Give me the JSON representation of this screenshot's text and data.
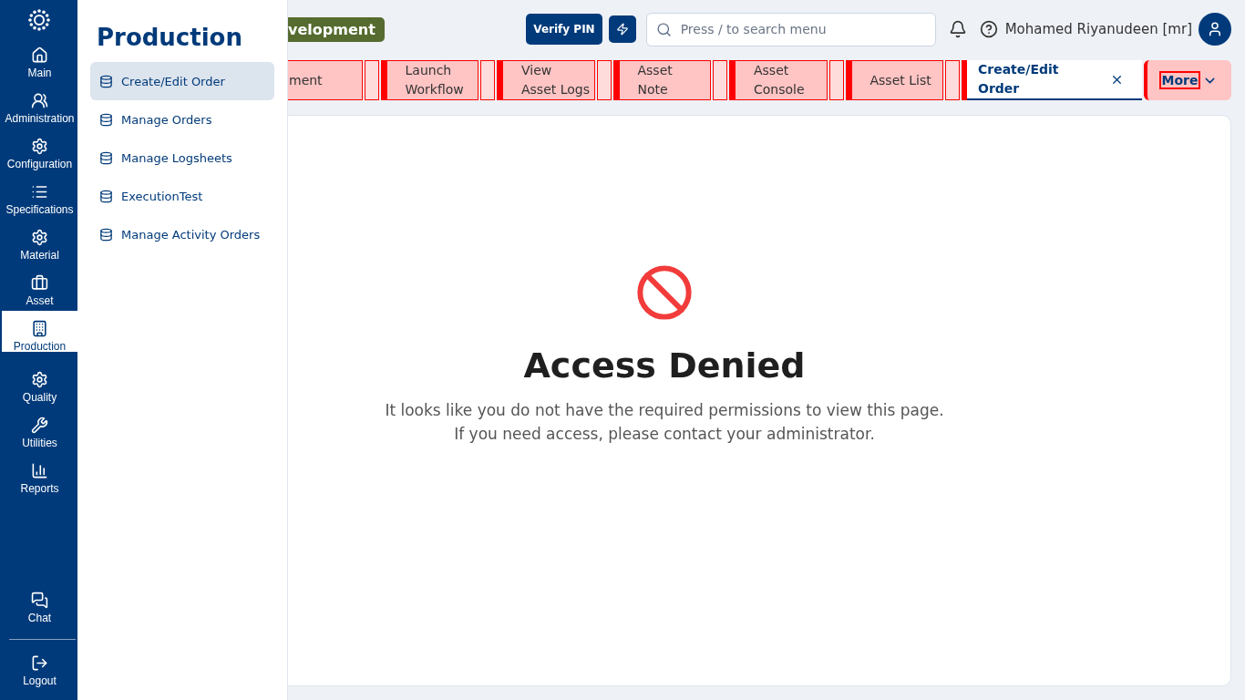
{
  "rail": {
    "items": [
      {
        "label": "Main",
        "selected": false
      },
      {
        "label": "Administration",
        "selected": false
      },
      {
        "label": "Configuration",
        "selected": false
      },
      {
        "label": "Specifications",
        "selected": false
      },
      {
        "label": "Material",
        "selected": false
      },
      {
        "label": "Asset",
        "selected": false
      },
      {
        "label": "Production",
        "selected": true
      },
      {
        "label": "Quality",
        "selected": false
      },
      {
        "label": "Utilities",
        "selected": false
      },
      {
        "label": "Reports",
        "selected": false
      }
    ],
    "bottom": [
      {
        "label": "Chat"
      },
      {
        "label": "Logout"
      }
    ]
  },
  "flyout": {
    "title": "Production",
    "items": [
      {
        "label": "Create/Edit Order",
        "selected": true
      },
      {
        "label": "Manage Orders",
        "selected": false
      },
      {
        "label": "Manage Logsheets",
        "selected": false
      },
      {
        "label": "ExecutionTest",
        "selected": false
      },
      {
        "label": "Manage Activity Orders",
        "selected": false
      }
    ]
  },
  "header": {
    "environment_badge": "velopment",
    "verify_button": "Verify PIN",
    "search": {
      "placeholder": "Press / to search menu"
    },
    "user_name": "Mohamed Riyanudeen [mr]"
  },
  "tabs": [
    {
      "label": "ment",
      "selected": false
    },
    {
      "label": "Launch Workflow",
      "selected": false
    },
    {
      "label": "View Asset Logs",
      "selected": false
    },
    {
      "label": "Asset Note",
      "selected": false
    },
    {
      "label": "Asset Console",
      "selected": false
    },
    {
      "label": "Asset List",
      "selected": false
    },
    {
      "label": "Create/Edit Order",
      "selected": true
    }
  ],
  "more_button": "More",
  "message": {
    "title": "Access Denied",
    "lines": [
      "It looks like you do not have the required permissions to view this page.",
      "If you need access, please contact your administrator."
    ]
  }
}
